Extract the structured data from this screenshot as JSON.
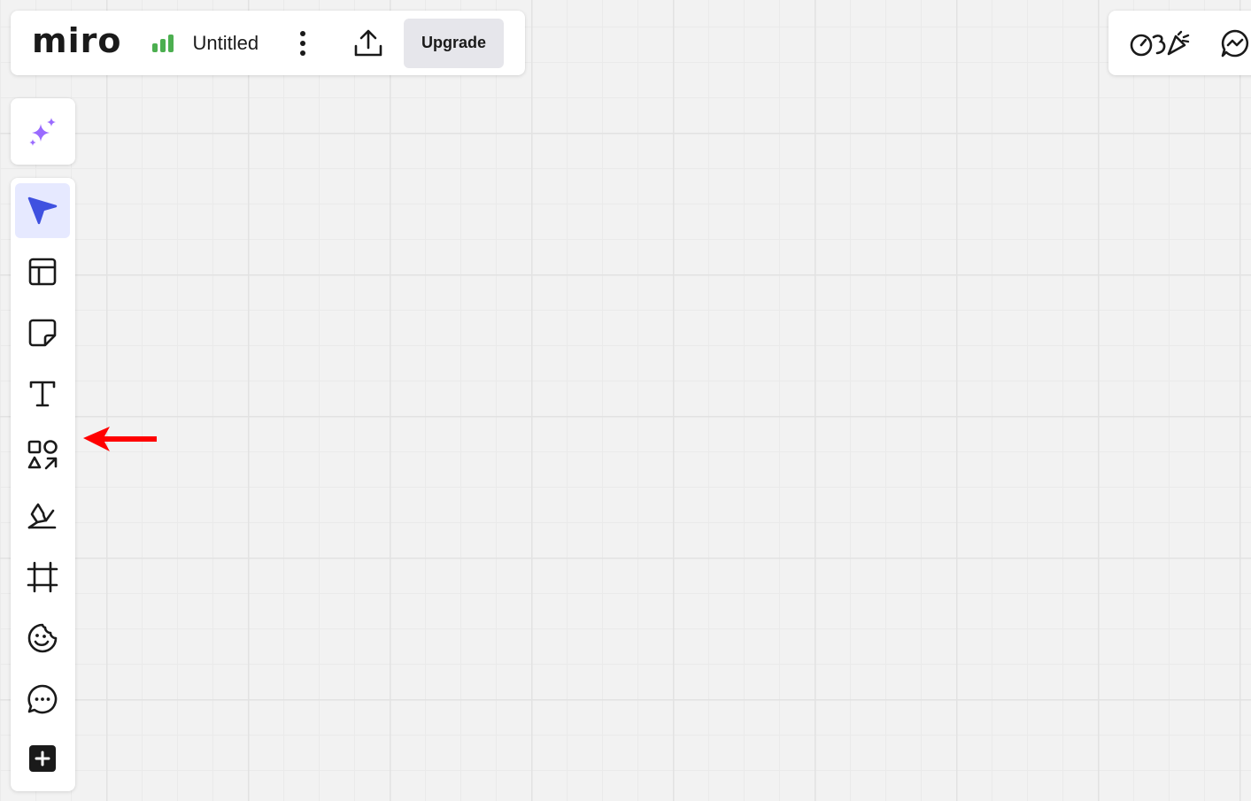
{
  "app": {
    "logo_text": "miro"
  },
  "header": {
    "board_title": "Untitled",
    "upgrade_label": "Upgrade",
    "plan_icon": "signal-bars-icon",
    "plan_icon_color": "#4caf50"
  },
  "toolbar": {
    "accent_color": "#3f51e0",
    "active_background": "#e6e9ff",
    "items": [
      {
        "name": "select",
        "icon": "cursor-arrow-icon",
        "active": true
      },
      {
        "name": "templates",
        "icon": "template-layout-icon",
        "active": false
      },
      {
        "name": "sticky-note",
        "icon": "sticky-note-icon",
        "active": false
      },
      {
        "name": "text",
        "icon": "text-icon",
        "active": false
      },
      {
        "name": "shapes",
        "icon": "shapes-icon",
        "active": false
      },
      {
        "name": "pen",
        "icon": "pen-icon",
        "active": false
      },
      {
        "name": "frame",
        "icon": "frame-icon",
        "active": false
      },
      {
        "name": "stickers",
        "icon": "sticker-icon",
        "active": false
      },
      {
        "name": "comment",
        "icon": "comment-icon",
        "active": false
      },
      {
        "name": "more-apps",
        "icon": "plus-square-icon",
        "active": false
      }
    ]
  },
  "ai": {
    "icon": "sparkles-icon",
    "color": "#9a6bff"
  },
  "annotation": {
    "icon": "red-arrow-icon",
    "color": "#ff0000"
  }
}
